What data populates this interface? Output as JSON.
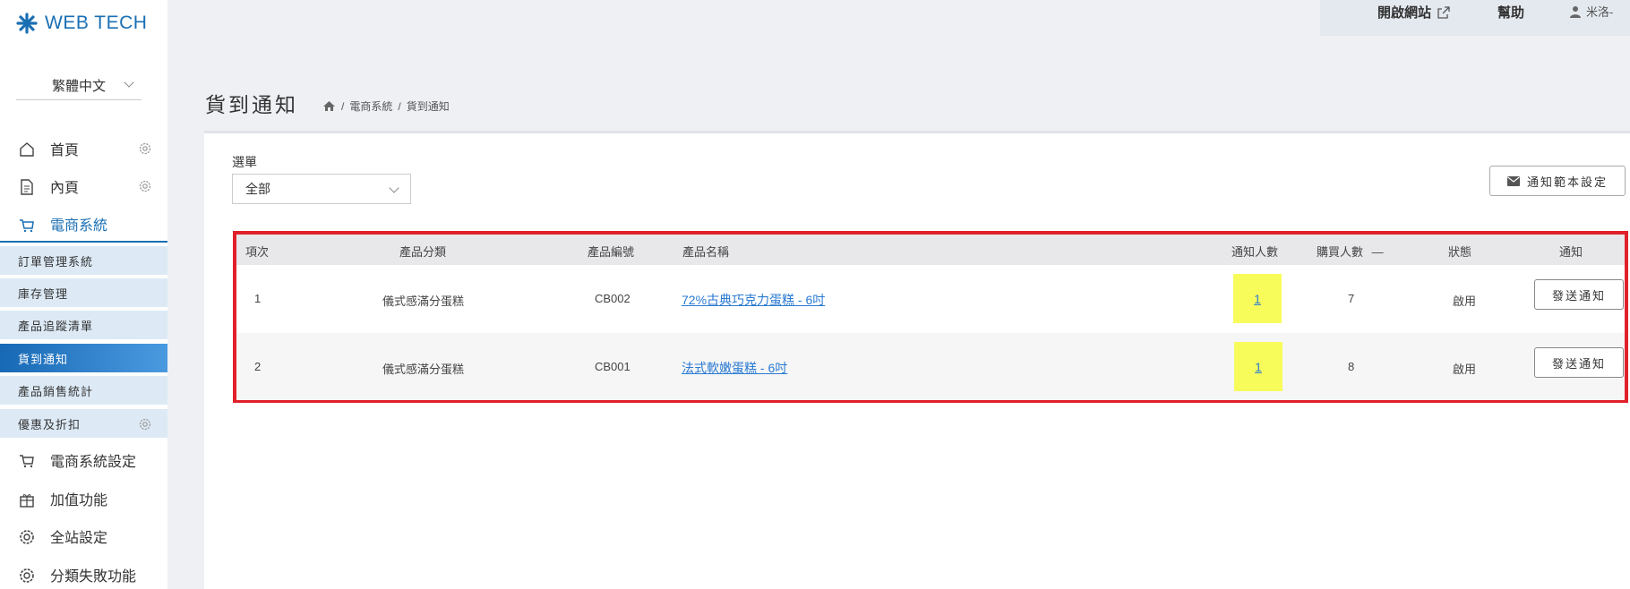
{
  "brand": {
    "logo_text": "WEB TECH",
    "logo_icon": "asterisk-logo-icon",
    "accent": "#1a6fb3"
  },
  "language": {
    "selected": "繁體中文"
  },
  "sidebar": {
    "main_items": [
      {
        "label": "首頁",
        "icon": "home-icon",
        "has_gear": true
      },
      {
        "label": "內頁",
        "icon": "document-icon",
        "has_gear": true
      },
      {
        "label": "電商系統",
        "icon": "cart-icon",
        "active": true
      }
    ],
    "sub_items": [
      {
        "label": "訂單管理系統"
      },
      {
        "label": "庫存管理"
      },
      {
        "label": "產品追蹤清單"
      },
      {
        "label": "貨到通知",
        "active": true
      },
      {
        "label": "產品銷售統計"
      },
      {
        "label": "優惠及折扣",
        "has_gear": true
      }
    ],
    "bottom_items": [
      {
        "label": "電商系統設定",
        "icon": "cart-icon"
      },
      {
        "label": "加值功能",
        "icon": "gift-icon"
      },
      {
        "label": "全站設定",
        "icon": "gear-icon"
      },
      {
        "label": "分類失敗功能",
        "icon": "gear-icon"
      }
    ]
  },
  "topbar": {
    "open_site": "開啟網站",
    "help": "幫助",
    "user": "米洛-"
  },
  "page": {
    "title": "貨到通知",
    "breadcrumb": [
      "電商系統",
      "貨到通知"
    ]
  },
  "filter": {
    "label": "選單",
    "value": "全部"
  },
  "template_button": "通知範本設定",
  "table": {
    "headers": [
      "項次",
      "產品分類",
      "產品編號",
      "產品名稱",
      "通知人數",
      "購買人數",
      "狀態",
      "通知"
    ],
    "sort_indicator": "—",
    "rows": [
      {
        "index": "1",
        "category": "儀式感滿分蛋糕",
        "code": "CB002",
        "name": "72%古典巧克力蛋糕 - 6吋",
        "notify_count": "1",
        "buy_count": "7",
        "status": "啟用",
        "action": "發送通知"
      },
      {
        "index": "2",
        "category": "儀式感滿分蛋糕",
        "code": "CB001",
        "name": "法式軟嫩蛋糕 - 6吋",
        "notify_count": "1",
        "buy_count": "8",
        "status": "啟用",
        "action": "發送通知"
      }
    ]
  },
  "colors": {
    "highlight_box": "#e0202a",
    "highlight_cell": "#f8fc5a",
    "active_sub": "#1769b5"
  }
}
